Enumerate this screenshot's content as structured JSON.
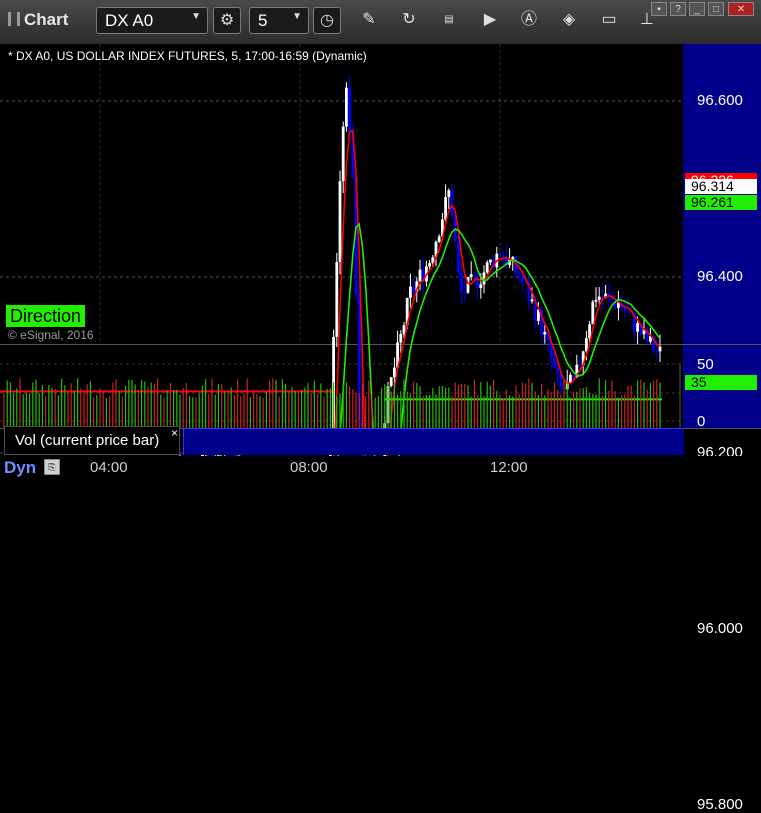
{
  "window": {
    "title": "Chart"
  },
  "toolbar": {
    "symbol": "DX A0",
    "interval": "5",
    "icons": [
      "cycle-settings-icon",
      "clock-icon",
      "pencil-icon",
      "refresh-icon",
      "get-icon",
      "play-icon",
      "alert-icon",
      "eraser-icon",
      "comment-icon",
      "pin-icon"
    ]
  },
  "chart": {
    "info_line": "* DX A0, US DOLLAR INDEX FUTURES, 5, 17:00-16:59 (Dynamic)",
    "direction_label": "Direction",
    "copyright": "© eSignal, 2016",
    "price_ticks": [
      "96.600",
      "96.400",
      "96.200",
      "96.000",
      "95.800"
    ],
    "price_tick_values": [
      96.6,
      96.4,
      96.2,
      96.0,
      95.8
    ],
    "price_range": [
      95.75,
      96.72
    ],
    "tags": {
      "red_partial": "96.326",
      "last": "96.314",
      "green": "96.261"
    },
    "colors": {
      "up": "#ffffff",
      "down": "#0000ff",
      "red_ma": "#ff0000",
      "green_ma": "#22ee00",
      "plot_bg": "#000000",
      "axis_bg": "#00008a"
    }
  },
  "volume": {
    "label": "Vol (current price bar)",
    "ticks": [
      "50",
      "0"
    ],
    "tag": "35"
  },
  "bottom": {
    "dyn_label": "Dyn",
    "time_labels": [
      "04:00",
      "08:00",
      "12:00"
    ]
  },
  "chart_data": {
    "type": "candlestick",
    "x": [
      "04:00",
      "08:00",
      "12:00"
    ],
    "price_lines": [
      {
        "name": "",
        "value": 96.261,
        "color": "#22ee00"
      },
      {
        "name": "",
        "value": 96.326,
        "color": "#ff0000"
      }
    ],
    "last_price": 96.314,
    "ylim": [
      95.75,
      96.72
    ],
    "volume_last": 35,
    "volume_ylim": [
      0,
      60
    ]
  }
}
